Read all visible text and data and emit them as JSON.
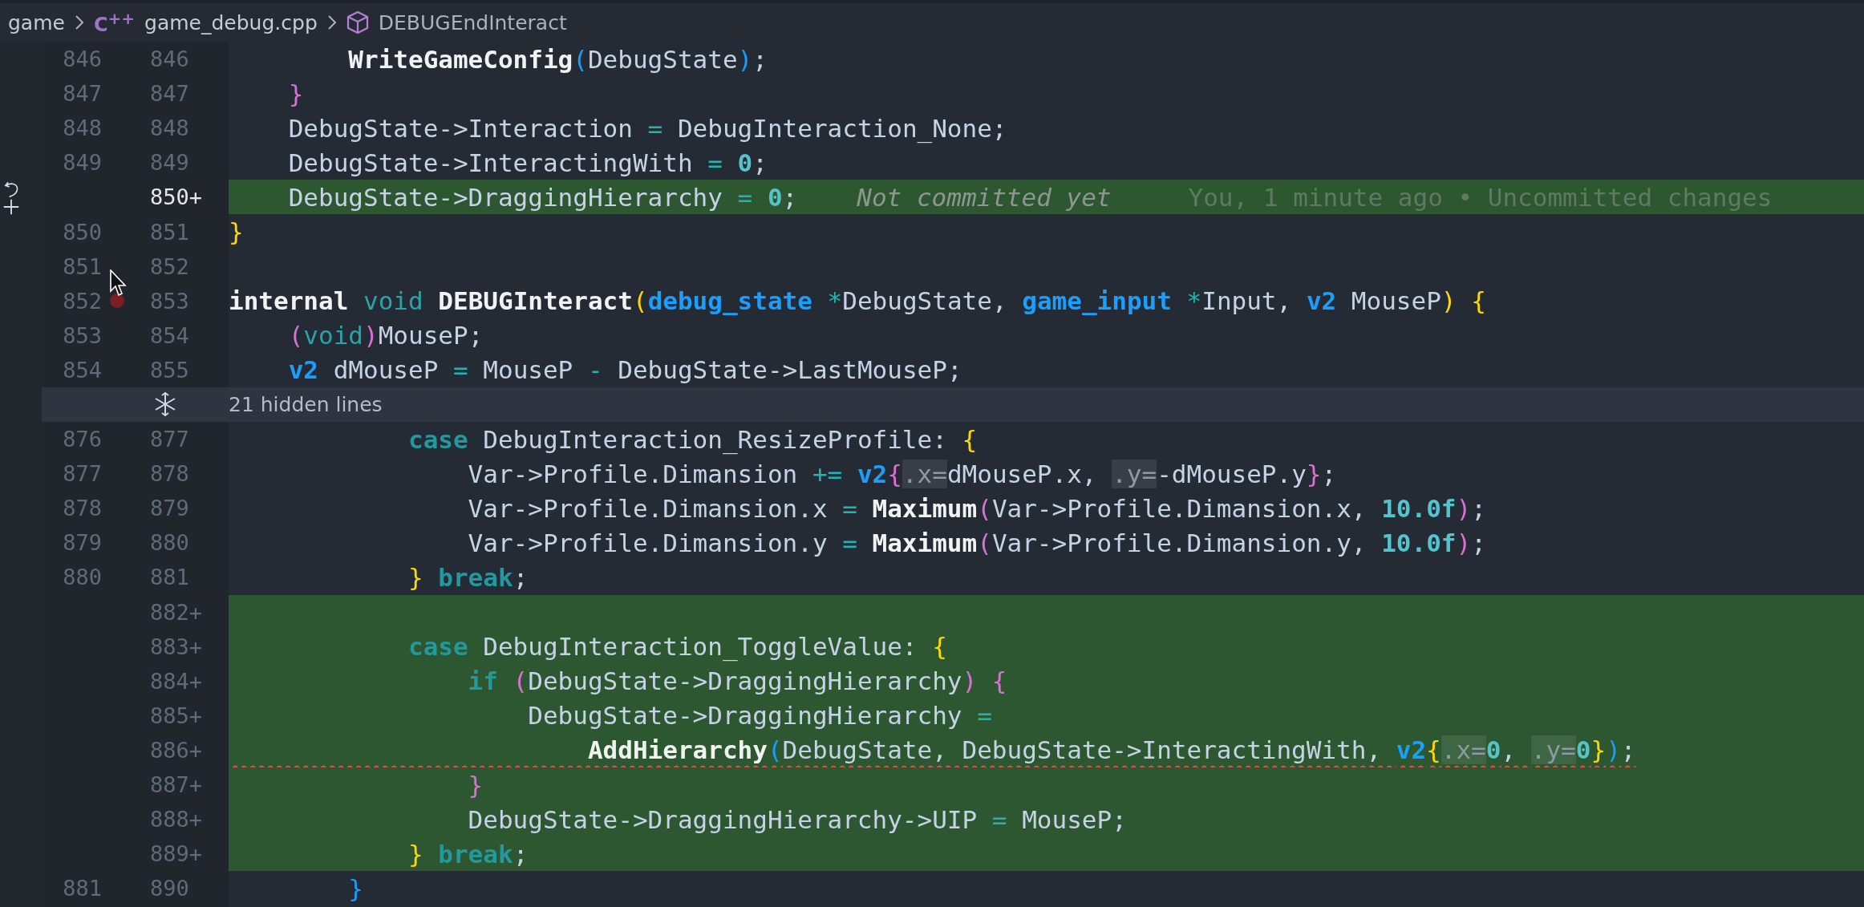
{
  "breadcrumb": {
    "folder": "game",
    "file_icon": "C$^{++}$",
    "file": "game_debug.cpp",
    "symbol": "DEBUGEndInteract"
  },
  "lines_top": [
    {
      "old": "846",
      "new": "846",
      "added": false,
      "code": [
        {
          "kind": "func",
          "text": "        WriteGameConfig"
        },
        {
          "kind": "b3",
          "text": "("
        },
        {
          "kind": "plain",
          "text": "DebugState"
        },
        {
          "kind": "b3",
          "text": ")"
        },
        {
          "kind": "plain",
          "text": ";"
        }
      ]
    },
    {
      "old": "847",
      "new": "847",
      "added": false,
      "code": [
        {
          "kind": "b2",
          "text": "    }"
        }
      ]
    },
    {
      "old": "848",
      "new": "848",
      "added": false,
      "code": [
        {
          "kind": "plain",
          "text": "    DebugState->Interaction "
        },
        {
          "kind": "op",
          "text": "="
        },
        {
          "kind": "plain",
          "text": " DebugInteraction_None;"
        }
      ]
    },
    {
      "old": "849",
      "new": "849",
      "added": false,
      "code": [
        {
          "kind": "plain",
          "text": "    DebugState->InteractingWith "
        },
        {
          "kind": "op",
          "text": "= "
        },
        {
          "kind": "num",
          "text": "0"
        },
        {
          "kind": "plain",
          "text": ";"
        }
      ]
    },
    {
      "new": "850+",
      "added": true,
      "current": true,
      "hunk_actions": true,
      "code": [
        {
          "kind": "plain",
          "text": "    DebugState->DraggingHierarchy "
        },
        {
          "kind": "op",
          "text": "= "
        },
        {
          "kind": "num",
          "text": "0"
        },
        {
          "kind": "plain",
          "text": ";"
        }
      ],
      "blame": {
        "status": "Not committed yet",
        "detail": "You, 1 minute ago • Uncommitted changes"
      }
    },
    {
      "old": "850",
      "new": "851",
      "added": false,
      "code": [
        {
          "kind": "b1",
          "text": "}"
        }
      ]
    },
    {
      "old": "851",
      "new": "852",
      "added": false
    },
    {
      "old": "852",
      "new": "853",
      "added": false,
      "breakpoint": true,
      "cursor": true,
      "code": [
        {
          "kind": "bold",
          "text": "internal "
        },
        {
          "kind": "storage",
          "text": "void "
        },
        {
          "kind": "func",
          "text": "DEBUGInteract"
        },
        {
          "kind": "b1",
          "text": "("
        },
        {
          "kind": "type",
          "text": "debug_state "
        },
        {
          "kind": "op",
          "text": "*"
        },
        {
          "kind": "plain",
          "text": "DebugState, "
        },
        {
          "kind": "type",
          "text": "game_input "
        },
        {
          "kind": "op",
          "text": "*"
        },
        {
          "kind": "plain",
          "text": "Input, "
        },
        {
          "kind": "type",
          "text": "v2"
        },
        {
          "kind": "plain",
          "text": " MouseP"
        },
        {
          "kind": "b1",
          "text": ") {"
        }
      ]
    },
    {
      "old": "853",
      "new": "854",
      "added": false,
      "code": [
        {
          "kind": "b2",
          "text": "    ("
        },
        {
          "kind": "storage",
          "text": "void"
        },
        {
          "kind": "b2",
          "text": ")"
        },
        {
          "kind": "plain",
          "text": "MouseP;"
        }
      ]
    },
    {
      "old": "854",
      "new": "855",
      "added": false,
      "code": [
        {
          "kind": "type",
          "text": "    v2"
        },
        {
          "kind": "plain",
          "text": " dMouseP "
        },
        {
          "kind": "op",
          "text": "="
        },
        {
          "kind": "plain",
          "text": " MouseP "
        },
        {
          "kind": "op",
          "text": "-"
        },
        {
          "kind": "plain",
          "text": " DebugState->LastMouseP;"
        }
      ]
    }
  ],
  "hidden_lines": "21 hidden lines",
  "lines_bottom": [
    {
      "old": "876",
      "new": "877",
      "added": false,
      "code": [
        {
          "kind": "keyword",
          "text": "            case"
        },
        {
          "kind": "plain",
          "text": " DebugInteraction_ResizeProfile: "
        },
        {
          "kind": "b1",
          "text": "{"
        }
      ]
    },
    {
      "old": "877",
      "new": "878",
      "added": false,
      "code": [
        {
          "kind": "plain",
          "text": "                Var->Profile.Dimansion "
        },
        {
          "kind": "op",
          "text": "+= "
        },
        {
          "kind": "type",
          "text": "v2"
        },
        {
          "kind": "b2",
          "text": "{"
        },
        {
          "kind": "hint",
          "text": ".x="
        },
        {
          "kind": "plain",
          "text": "dMouseP.x, "
        },
        {
          "kind": "hint",
          "text": ".y="
        },
        {
          "kind": "plain",
          "text": "-dMouseP.y"
        },
        {
          "kind": "b2",
          "text": "}"
        },
        {
          "kind": "plain",
          "text": ";"
        }
      ]
    },
    {
      "old": "878",
      "new": "879",
      "added": false,
      "code": [
        {
          "kind": "plain",
          "text": "                Var->Profile.Dimansion.x "
        },
        {
          "kind": "op",
          "text": "= "
        },
        {
          "kind": "func",
          "text": "Maximum"
        },
        {
          "kind": "b2",
          "text": "("
        },
        {
          "kind": "plain",
          "text": "Var->Profile.Dimansion.x, "
        },
        {
          "kind": "num",
          "text": "10.0f"
        },
        {
          "kind": "b2",
          "text": ")"
        },
        {
          "kind": "plain",
          "text": ";"
        }
      ]
    },
    {
      "old": "879",
      "new": "880",
      "added": false,
      "code": [
        {
          "kind": "plain",
          "text": "                Var->Profile.Dimansion.y "
        },
        {
          "kind": "op",
          "text": "= "
        },
        {
          "kind": "func",
          "text": "Maximum"
        },
        {
          "kind": "b2",
          "text": "("
        },
        {
          "kind": "plain",
          "text": "Var->Profile.Dimansion.y, "
        },
        {
          "kind": "num",
          "text": "10.0f"
        },
        {
          "kind": "b2",
          "text": ")"
        },
        {
          "kind": "plain",
          "text": ";"
        }
      ]
    },
    {
      "old": "880",
      "new": "881",
      "added": false,
      "code": [
        {
          "kind": "b1",
          "text": "            } "
        },
        {
          "kind": "keyword",
          "text": "break"
        },
        {
          "kind": "plain",
          "text": ";"
        }
      ]
    },
    {
      "new": "882+",
      "added": true
    },
    {
      "new": "883+",
      "added": true,
      "code": [
        {
          "kind": "keyword",
          "text": "            case"
        },
        {
          "kind": "plain",
          "text": " DebugInteraction_ToggleValue: "
        },
        {
          "kind": "b1",
          "text": "{"
        }
      ]
    },
    {
      "new": "884+",
      "added": true,
      "code": [
        {
          "kind": "keyword",
          "text": "                if "
        },
        {
          "kind": "b2",
          "text": "("
        },
        {
          "kind": "plain",
          "text": "DebugState->DraggingHierarchy"
        },
        {
          "kind": "b2",
          "text": ") {"
        }
      ]
    },
    {
      "new": "885+",
      "added": true,
      "code": [
        {
          "kind": "plain",
          "text": "                    DebugState->DraggingHierarchy "
        },
        {
          "kind": "op",
          "text": "="
        }
      ]
    },
    {
      "new": "886+",
      "added": true,
      "error": true,
      "code": [
        {
          "kind": "func",
          "text": "                        AddHierarchy"
        },
        {
          "kind": "b3",
          "text": "("
        },
        {
          "kind": "plain",
          "text": "DebugState, DebugState->InteractingWith, "
        },
        {
          "kind": "type",
          "text": "v2"
        },
        {
          "kind": "b1",
          "text": "{"
        },
        {
          "kind": "hint",
          "text": ".x="
        },
        {
          "kind": "num",
          "text": "0"
        },
        {
          "kind": "plain",
          "text": ", "
        },
        {
          "kind": "hint",
          "text": ".y="
        },
        {
          "kind": "num",
          "text": "0"
        },
        {
          "kind": "b1",
          "text": "}"
        },
        {
          "kind": "b3",
          "text": ")"
        },
        {
          "kind": "plain",
          "text": ";"
        }
      ]
    },
    {
      "new": "887+",
      "added": true,
      "code": [
        {
          "kind": "b2",
          "text": "                }"
        }
      ]
    },
    {
      "new": "888+",
      "added": true,
      "code": [
        {
          "kind": "plain",
          "text": "                DebugState->DraggingHierarchy->UIP "
        },
        {
          "kind": "op",
          "text": "="
        },
        {
          "kind": "plain",
          "text": " MouseP;"
        }
      ]
    },
    {
      "new": "889+",
      "added": true,
      "code": [
        {
          "kind": "b1",
          "text": "            } "
        },
        {
          "kind": "keyword",
          "text": "break"
        },
        {
          "kind": "plain",
          "text": ";"
        }
      ]
    },
    {
      "old": "881",
      "new": "890",
      "added": false,
      "code": [
        {
          "kind": "b3",
          "text": "        }"
        }
      ]
    }
  ]
}
